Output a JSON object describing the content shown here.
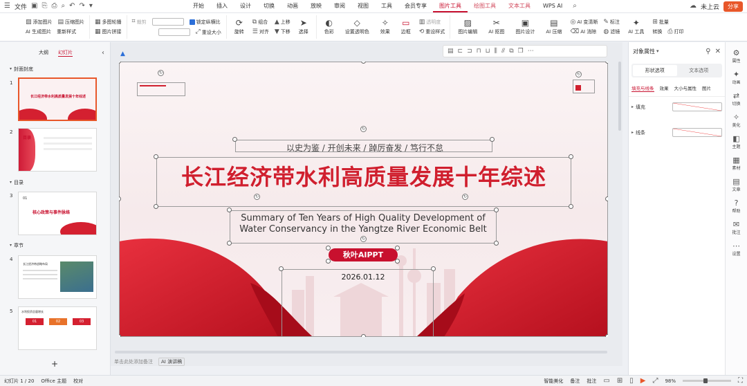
{
  "topbar": {
    "file_label": "文件",
    "tabs": [
      "开始",
      "插入",
      "设计",
      "切换",
      "动画",
      "放映",
      "审阅",
      "视图",
      "工具",
      "会员专享",
      "图片工具",
      "绘图工具",
      "文本工具",
      "WPS AI"
    ],
    "active_tab": "图片工具",
    "cloud_label": "未上云",
    "share_label": "分享"
  },
  "ribbon": {
    "add_image": "添加图片",
    "ai_gen_image": "AI 生成图片",
    "compress": "压缩图片",
    "reset_style": "重新样式",
    "multi_contour": "多图轮播",
    "image_splice": "图片拼接",
    "crop": "裁剪",
    "lock_ratio": "锁定纵横比",
    "reset_size": "重设大小",
    "rotate": "旋转",
    "combine": "组合",
    "align": "对齐",
    "move_up": "上移",
    "move_down": "下移",
    "select": "选择",
    "color": "色彩",
    "set_transparent": "设置透明色",
    "effect": "效果",
    "border": "边框",
    "transparency": "透明度",
    "reset_style2": "重设样式",
    "image_edit": "图片编辑",
    "ai_matting": "AI 抠图",
    "image_design": "图片设计",
    "ai_compress": "AI 压缩",
    "ai_hd": "AI 变清晰",
    "ai_erase": "AI 消除",
    "annotate": "标注",
    "filter": "滤镜",
    "ai_tools": "AI 工具",
    "batch": "批量",
    "convert": "转换",
    "print": "打印"
  },
  "leftpanel": {
    "tab_outline": "大纲",
    "tab_slides": "幻灯片",
    "sections": [
      "封面封底",
      "目录",
      "章节"
    ],
    "thumbs": [
      {
        "num": "1",
        "title": "长江经济带水利高质量发展十年综述"
      },
      {
        "num": "2",
        "title": "目录"
      },
      {
        "num": "3",
        "title": "核心政策与事件脉络",
        "small": "01"
      },
      {
        "num": "4",
        "title": "长江经济带战略布局"
      },
      {
        "num": "5",
        "title": "水利投资总量增长",
        "steps": [
          "01",
          "02",
          "03"
        ]
      }
    ],
    "add_slide": "+"
  },
  "slide": {
    "motto": "以史为鉴 / 开创未来 / 踔厉奋发 / 笃行不怠",
    "title_cn": "长江经济带水利高质量发展十年综述",
    "title_en_1": "Summary of Ten Years of High Quality Development of",
    "title_en_2": "Water Conservancy in the Yangtze River Economic Belt",
    "author": "秋叶AIPPT",
    "date": "2026.01.12"
  },
  "notes_placeholder": "单击此处添加备注",
  "ai_notes": "AI 演讲稿",
  "rightpanel": {
    "title": "对象属性",
    "tab_shape": "形状选项",
    "tab_text": "文本选项",
    "subtabs": [
      "填充与线条",
      "效果",
      "大小与属性",
      "图片"
    ],
    "fill_label": "填充",
    "line_label": "线条"
  },
  "rightbar": [
    "属性",
    "动画",
    "切换",
    "美化",
    "主题",
    "素材",
    "文章",
    "帮助",
    "批注",
    "设置"
  ],
  "status": {
    "slide_count": "幻灯片 1 / 20",
    "theme": "Office 主题",
    "proofing": "校对",
    "smart_beautify": "智能美化",
    "notes": "备注",
    "comments": "批注",
    "zoom": "98%"
  },
  "colors": {
    "accent": "#c8102e",
    "share": "#e8572a"
  }
}
